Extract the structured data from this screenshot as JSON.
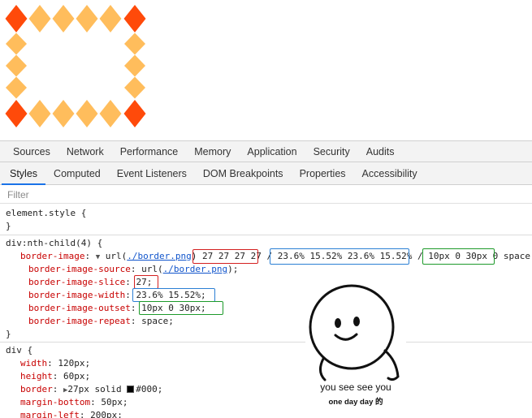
{
  "main_tabs": [
    "Sources",
    "Network",
    "Performance",
    "Memory",
    "Application",
    "Security",
    "Audits"
  ],
  "sub_tabs": [
    "Styles",
    "Computed",
    "Event Listeners",
    "DOM Breakpoints",
    "Properties",
    "Accessibility"
  ],
  "active_sub_tab": "Styles",
  "filter": {
    "placeholder": "Filter",
    "value": ""
  },
  "element_style": {
    "selector": "element.style {",
    "close": "}"
  },
  "rule1": {
    "selector": "div:nth-child(4) {",
    "shorthand_prop": "border-image",
    "shorthand_url_prefix": "url(",
    "shorthand_url": "./border.png",
    "shorthand_url_suffix": ")",
    "slice": "27 27 27 27",
    "slash1": "/",
    "width": "23.6% 15.52% 23.6% 15.52%",
    "slash2": "/",
    "outset": "10px 0 30px 0",
    "repeat": "space;",
    "longhands": [
      {
        "prop": "border-image-source",
        "pre": "url(",
        "link": "./border.png",
        "post": ");"
      },
      {
        "prop": "border-image-slice",
        "value": "27;"
      },
      {
        "prop": "border-image-width",
        "value": "23.6% 15.52%;"
      },
      {
        "prop": "border-image-outset",
        "value": "10px 0 30px;"
      },
      {
        "prop": "border-image-repeat",
        "value": "space;"
      }
    ],
    "close": "}"
  },
  "rule2": {
    "selector": "div {",
    "decls": [
      {
        "prop": "width",
        "value": "120px;"
      },
      {
        "prop": "height",
        "value": "60px;"
      },
      {
        "prop": "border",
        "value": "27px solid",
        "color": "#000;"
      },
      {
        "prop": "margin-bottom",
        "value": "50px;"
      },
      {
        "prop": "margin-left",
        "value": "200px;"
      }
    ]
  },
  "meme": {
    "line1": "you see see you",
    "line2": "one day day 的"
  },
  "colors": {
    "diamond_orange": "#ffbd5c",
    "diamond_red": "#ff4a0a",
    "highlight_red": "#d42020",
    "highlight_blue": "#2b7fd4",
    "highlight_green": "#1d9a2a",
    "css_prop": "#c80000",
    "link": "#1155cc"
  }
}
